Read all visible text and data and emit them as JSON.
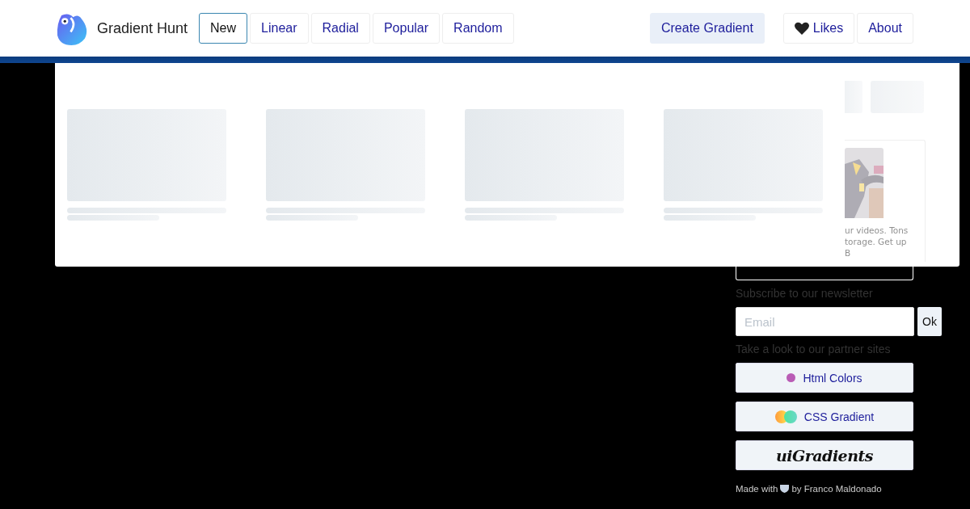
{
  "header": {
    "logo_text": "Gradient Hunt",
    "tabs": [
      {
        "label": "New",
        "selected": true
      },
      {
        "label": "Linear",
        "selected": false
      },
      {
        "label": "Radial",
        "selected": false
      },
      {
        "label": "Popular",
        "selected": false
      },
      {
        "label": "Random",
        "selected": false
      }
    ],
    "actions": [
      {
        "kind": "primary",
        "label": "Create Gradient"
      },
      {
        "kind": "heart",
        "label": "Likes"
      },
      {
        "kind": "plain",
        "label": "About"
      }
    ]
  },
  "ad_fragment": {
    "lines": [
      "ur videos. Tons",
      "torage. Get up",
      "B"
    ]
  },
  "sidebar": {
    "newsletter_label": "Subscribe to our newsletter",
    "email": {
      "placeholder": "Email"
    },
    "submit": "Ok",
    "partners_label": "Take a look to our partner sites",
    "partners": [
      {
        "kind": "dot",
        "label": "Html Colors"
      },
      {
        "kind": "circles",
        "label": "CSS Gradient"
      },
      {
        "kind": "script",
        "label": "uiGradients"
      }
    ],
    "footer": {
      "prefix": "Made with",
      "suffix": "by Franco Maldonado"
    }
  }
}
